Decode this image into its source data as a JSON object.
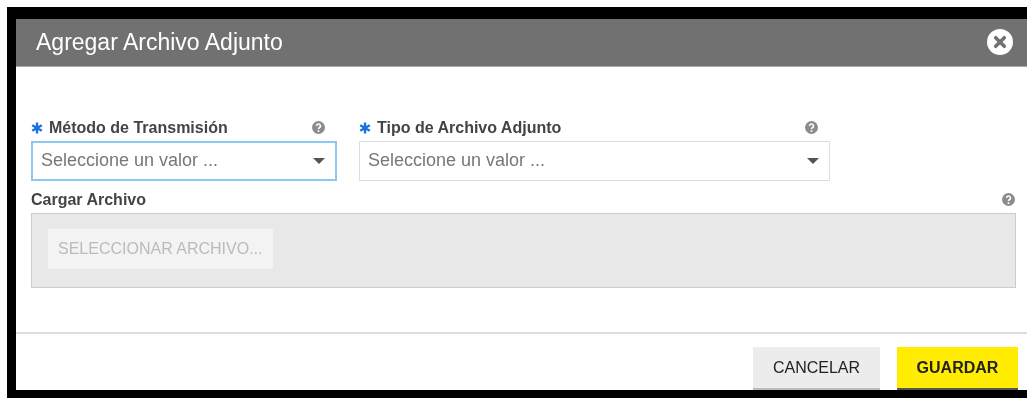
{
  "dialog": {
    "title": "Agregar Archivo Adjunto"
  },
  "fields": [
    {
      "label": "Método de Transmisión",
      "required": true,
      "placeholder": "Seleccione un valor ...",
      "focused": true
    },
    {
      "label": "Tipo de Archivo Adjunto",
      "required": true,
      "placeholder": "Seleccione un valor ...",
      "focused": false
    }
  ],
  "upload": {
    "label": "Cargar Archivo",
    "button": "SELECCIONAR ARCHIVO...",
    "disabled": true
  },
  "buttons": [
    {
      "label": "CANCELAR",
      "kind": "secondary"
    },
    {
      "label": "GUARDAR",
      "kind": "primary"
    }
  ]
}
